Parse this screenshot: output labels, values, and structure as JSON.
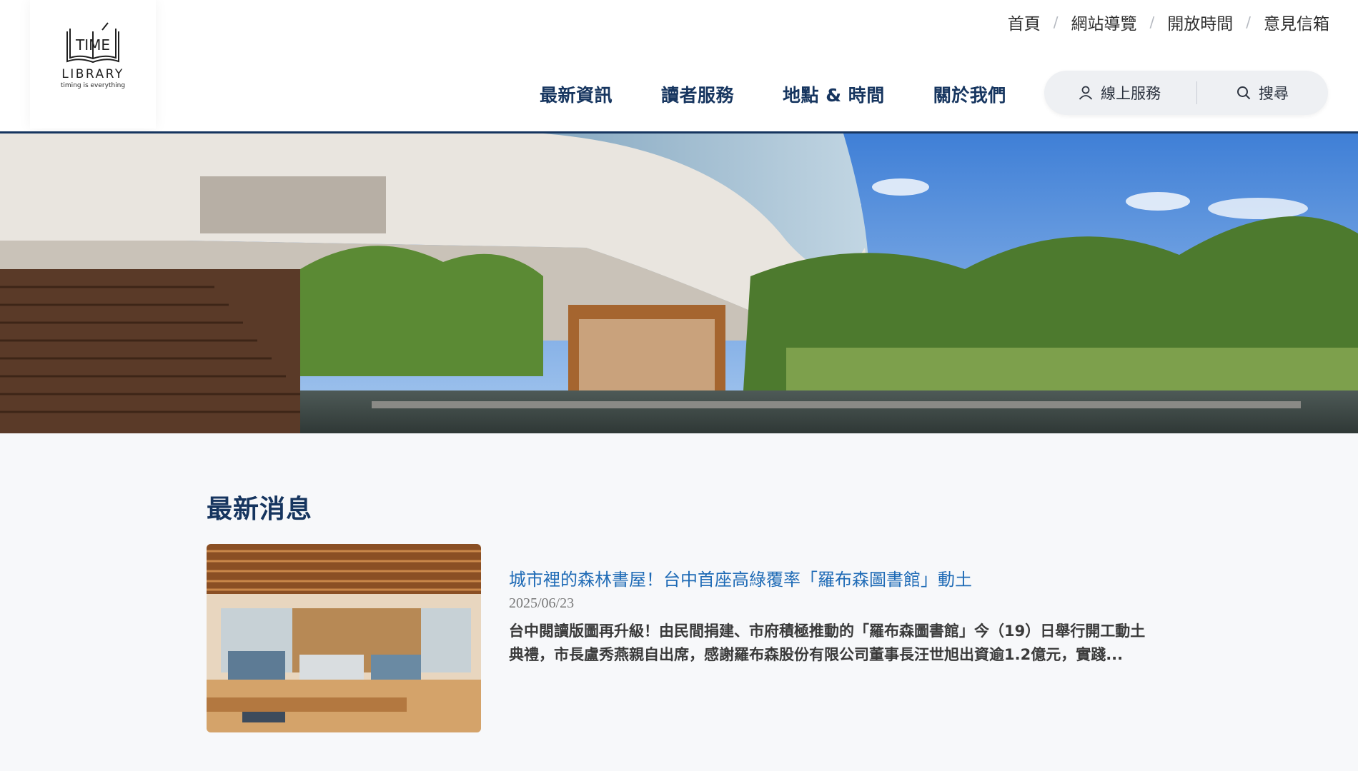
{
  "logo": {
    "word": "LIBRARY",
    "tagline": "timing is everything",
    "mark_text": "TIME"
  },
  "top_links": [
    {
      "label": "首頁"
    },
    {
      "label": "網站導覽"
    },
    {
      "label": "開放時間"
    },
    {
      "label": "意見信箱"
    }
  ],
  "top_links_separator": "/",
  "main_nav": [
    {
      "label": "最新資訊"
    },
    {
      "label": "讀者服務"
    },
    {
      "label": "地點 & 時間"
    },
    {
      "label": "關於我們"
    }
  ],
  "utility": {
    "service_label": "線上服務",
    "search_label": "搜尋"
  },
  "news_section": {
    "title": "最新消息",
    "items": [
      {
        "headline": "城市裡的森林書屋！台中首座高綠覆率「羅布森圖書館」動土",
        "date": "2025/06/23",
        "excerpt": "台中閱讀版圖再升級！由民間捐建、市府積極推動的「羅布森圖書館」今（19）日舉行開工動土典禮，市長盧秀燕親自出席，感謝羅布森股份有限公司董事長汪世旭出資逾1.2億元，實踐..."
      }
    ]
  },
  "colors": {
    "brand_navy": "#16355f",
    "link_blue": "#1f6bb6",
    "page_bg": "#f7f8fa"
  }
}
